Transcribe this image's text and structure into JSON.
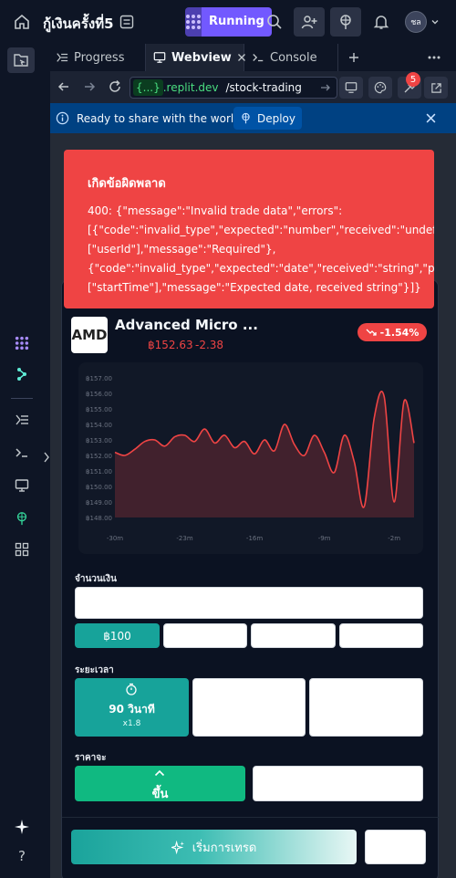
{
  "topbar": {
    "repl_name": "กู้เงินครั้งที่5",
    "run_label": "Running",
    "avatar_initials": "ชล"
  },
  "tabs": [
    {
      "label": "Progress"
    },
    {
      "label": "Webview"
    },
    {
      "label": "Console"
    }
  ],
  "urlbar": {
    "domain_prefix": "{...}",
    "domain": ".replit.dev",
    "path": "/stock-trading",
    "notification_count": "5"
  },
  "banner": {
    "text": "Ready to share with the world?",
    "deploy_label": "Deploy"
  },
  "error": {
    "title": "เกิดข้อผิดพลาด",
    "message": "400: {\"message\":\"Invalid trade data\",\"errors\":\n[{\"code\":\"invalid_type\",\"expected\":\"number\",\"received\":\"undefined\",\"path\":\n[\"userId\"],\"message\":\"Required\"},\n{\"code\":\"invalid_type\",\"expected\":\"date\",\"received\":\"string\",\"path\":\n[\"startTime\"],\"message\":\"Expected date, received string\"}]}"
  },
  "stock": {
    "logo_text": "AMD",
    "name": "Advanced Micro ...",
    "price": "฿152.63",
    "change": "-2.38",
    "change_pct": "-1.54%"
  },
  "chart_data": {
    "type": "area",
    "title": "",
    "y_ticks": [
      "฿157.00",
      "฿156.00",
      "฿155.00",
      "฿154.00",
      "฿153.00",
      "฿152.00",
      "฿151.00",
      "฿150.00",
      "฿149.00",
      "฿148.00"
    ],
    "x_ticks": [
      "-30m",
      "-23m",
      "-16m",
      "-9m",
      "-2m"
    ],
    "ylim": [
      148,
      157
    ],
    "xlim": [
      -30,
      0
    ],
    "series": [
      {
        "x": [
          -30,
          -29,
          -28,
          -27,
          -26,
          -25,
          -24,
          -23,
          -22,
          -21,
          -20,
          -19,
          -18,
          -17,
          -16,
          -15,
          -14,
          -13,
          -12,
          -11,
          -10,
          -9,
          -8,
          -7,
          -6,
          -5,
          -4,
          -3,
          -2,
          -1,
          0
        ],
        "values": [
          152.2,
          152.0,
          152.4,
          152.9,
          153.0,
          152.6,
          153.2,
          153.3,
          152.9,
          153.7,
          152.8,
          153.3,
          152.5,
          152.9,
          152.1,
          153.0,
          152.3,
          154.0,
          152.7,
          152.0,
          153.3,
          152.2,
          150.9,
          153.3,
          151.6,
          148.7,
          154.4,
          155.8,
          149.0,
          155.5,
          152.8
        ]
      }
    ],
    "line_color": "#ef4444"
  },
  "amount": {
    "label": "จำนวนเงิน",
    "presets": [
      "฿100",
      "",
      "",
      ""
    ]
  },
  "duration": {
    "label": "ระยะเวลา",
    "options": [
      {
        "title": "90 วินาที",
        "mult": "x1.8"
      }
    ]
  },
  "prediction": {
    "label": "ราคาจะ",
    "up_label": "ขึ้น"
  },
  "trade": {
    "start_label": "เริ่มการเทรด"
  }
}
